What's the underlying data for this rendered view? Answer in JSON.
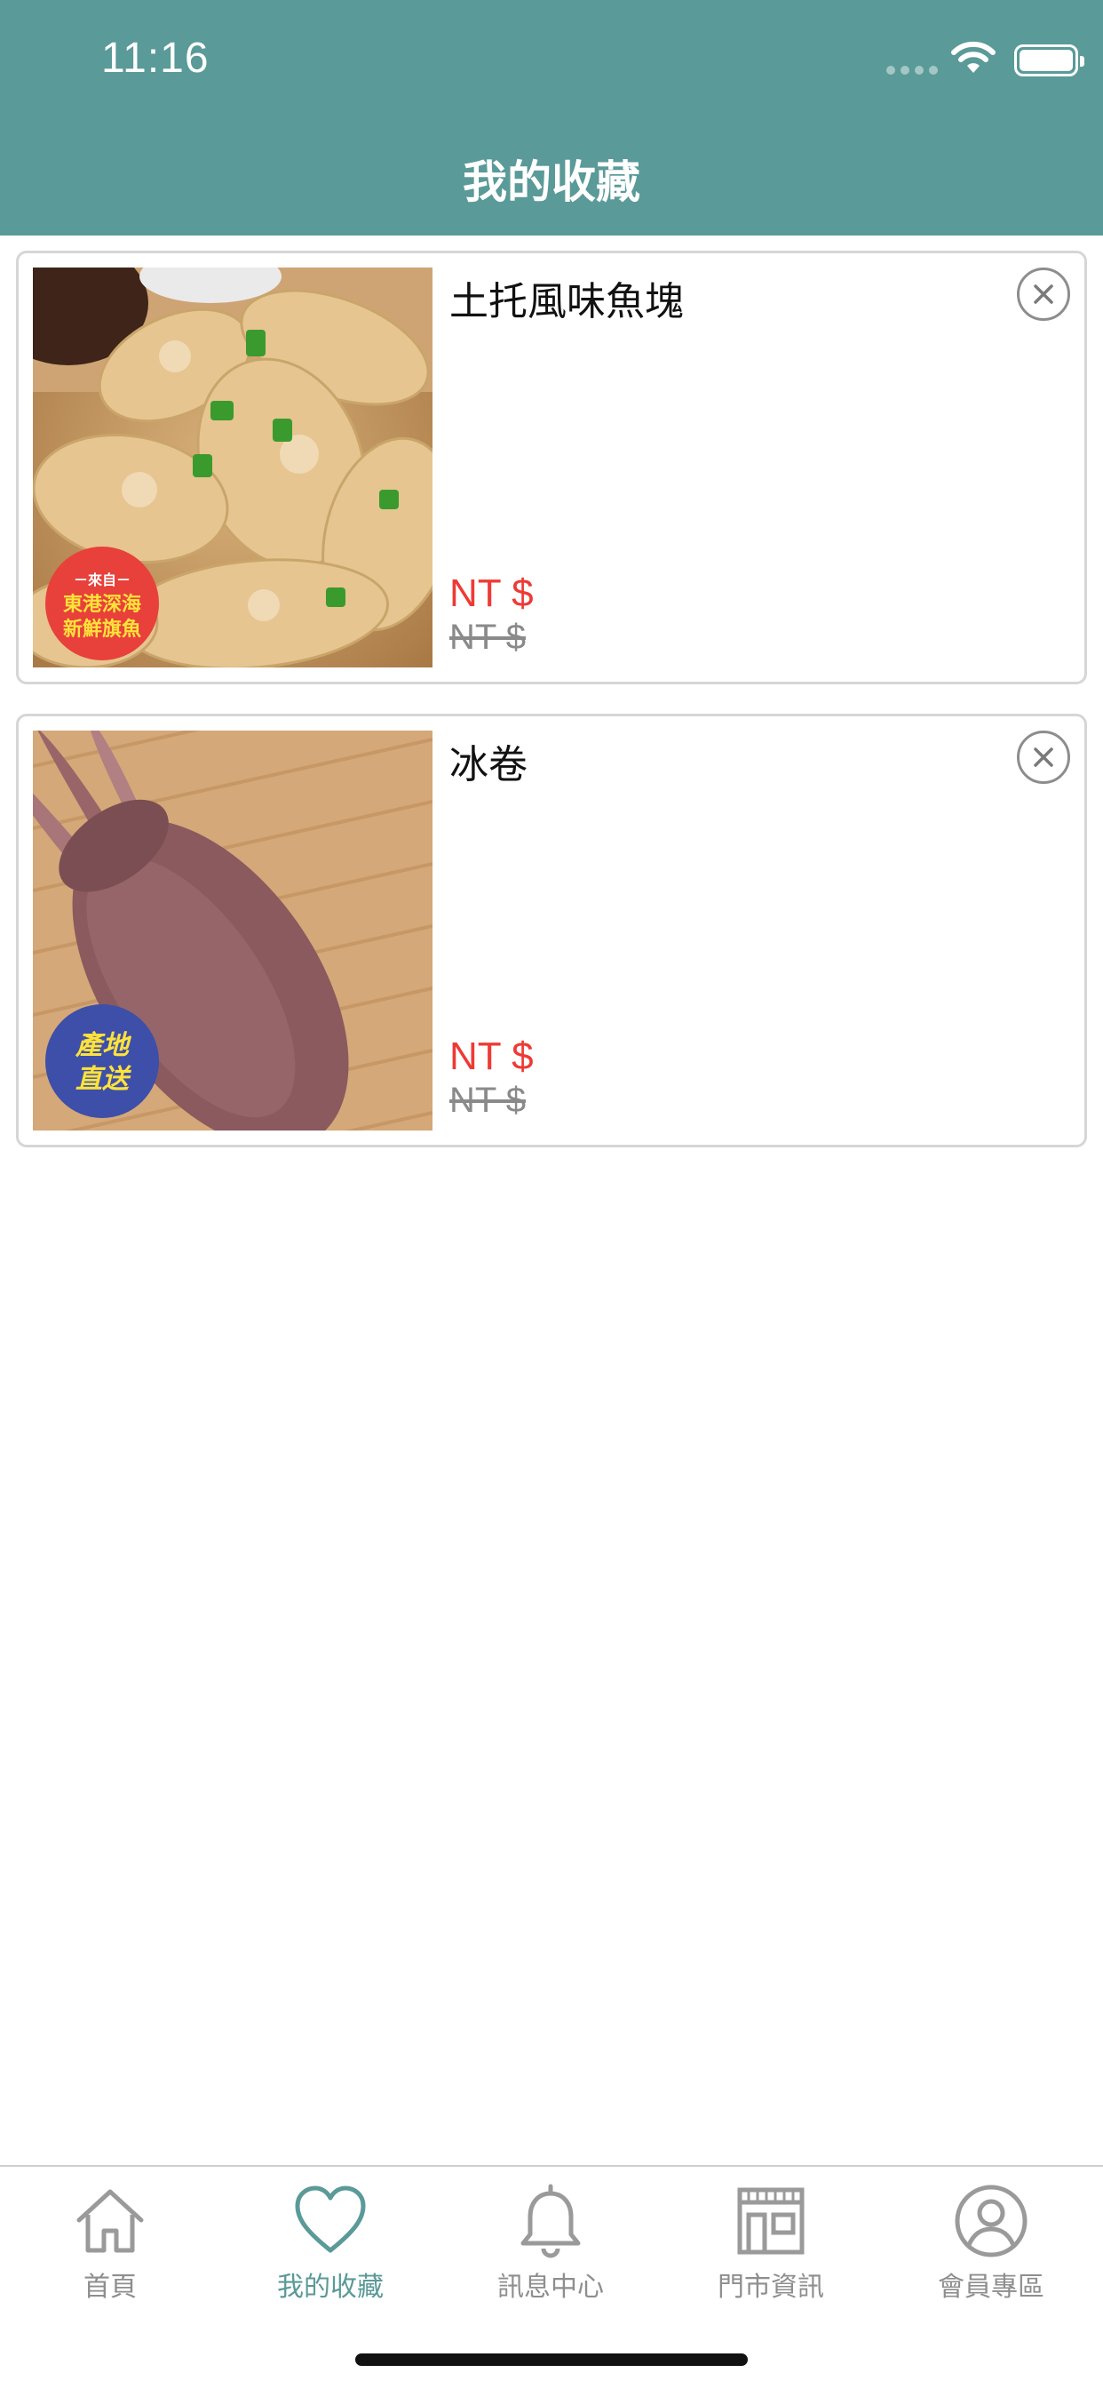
{
  "status_bar": {
    "time": "11:16"
  },
  "header": {
    "title": "我的收藏"
  },
  "favorites": [
    {
      "title": "土托風味魚塊",
      "price": "NT $",
      "original_price": "NT $",
      "image": "fried-fish-nuggets",
      "badge": {
        "line1": "－來自－",
        "line2": "東港深海",
        "line3": "新鮮旗魚",
        "color": "#e8403a"
      }
    },
    {
      "title": "冰卷",
      "price": "NT $",
      "original_price": "NT $",
      "image": "squid",
      "badge": {
        "line1": "產地",
        "line2": "直送",
        "color": "#3d4fa8"
      }
    }
  ],
  "tabbar": {
    "tabs": [
      {
        "label": "首頁",
        "icon": "home-icon",
        "active": false
      },
      {
        "label": "我的收藏",
        "icon": "heart-icon",
        "active": true
      },
      {
        "label": "訊息中心",
        "icon": "bell-icon",
        "active": false
      },
      {
        "label": "門市資訊",
        "icon": "store-icon",
        "active": false
      },
      {
        "label": "會員專區",
        "icon": "user-icon",
        "active": false
      }
    ]
  },
  "colors": {
    "header": "#5a9a98",
    "price": "#ee3a35",
    "active_tab": "#5a9a98",
    "inactive_tab": "#8e8e8e"
  }
}
